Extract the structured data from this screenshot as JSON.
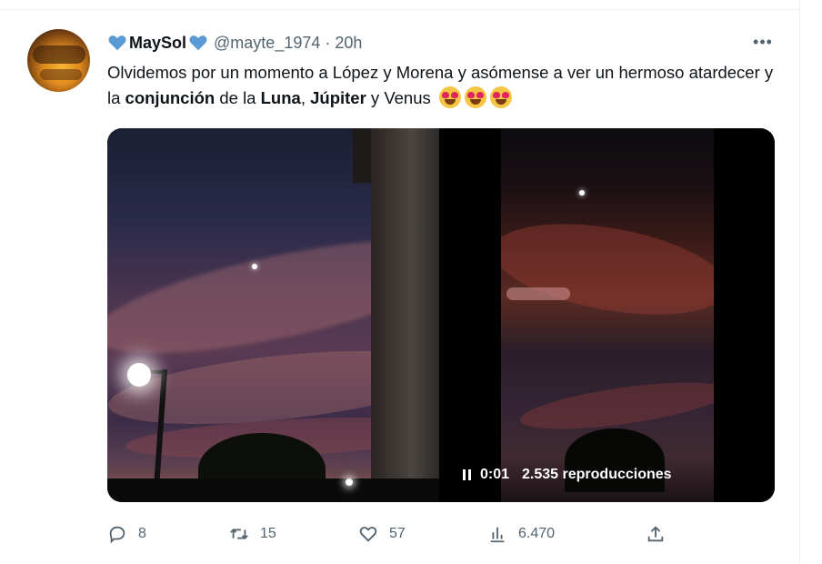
{
  "tweet": {
    "author_name": "MaySol",
    "handle": "@mayte_1974",
    "separator": "·",
    "time": "20h",
    "more_label": "•••",
    "text": {
      "p1": "Olvidemos por un momento a López y Morena y asómense a ver un hermoso atardecer y la ",
      "b1": "conjunción",
      "p2": " de la ",
      "b2": "Luna",
      "p3": ", ",
      "b3": "Júpiter",
      "p4": " y Venus "
    },
    "emojis": [
      "heart-eyes-emoji",
      "heart-eyes-emoji",
      "heart-eyes-emoji"
    ]
  },
  "video": {
    "time": "0:01",
    "views": "2.535 reproducciones"
  },
  "actions": {
    "replies": "8",
    "retweets": "15",
    "likes": "57",
    "views": "6.470"
  },
  "colors": {
    "text": "#0f1419",
    "secondary": "#536471",
    "heart": "#5b9bd5"
  },
  "icons": [
    "blue-heart-icon",
    "more-icon",
    "pause-icon",
    "reply-icon",
    "retweet-icon",
    "like-icon",
    "views-icon",
    "share-icon"
  ]
}
